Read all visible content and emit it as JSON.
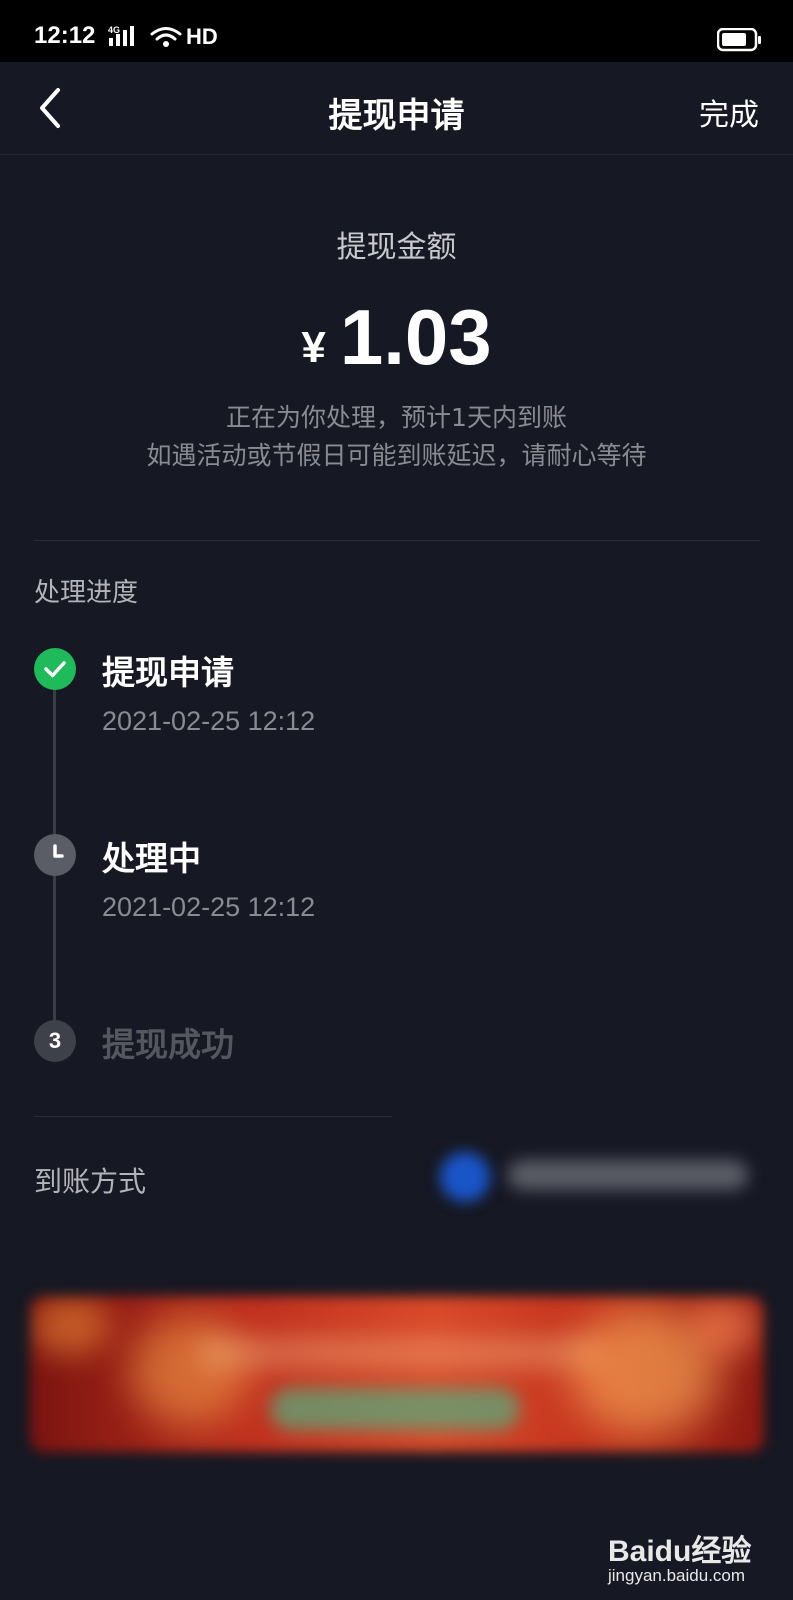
{
  "status_bar": {
    "time": "12:12",
    "network": "4G",
    "hd": "HD",
    "icons": [
      "signal-icon",
      "wifi-icon",
      "battery-icon"
    ]
  },
  "nav": {
    "back_icon": "chevron-left-icon",
    "title": "提现申请",
    "done": "完成"
  },
  "amount": {
    "label": "提现金额",
    "currency": "¥",
    "value": "1.03",
    "note_line1": "正在为你处理，预计1天内到账",
    "note_line2": "如遇活动或节假日可能到账延迟，请耐心等待"
  },
  "progress": {
    "title": "处理进度",
    "steps": [
      {
        "title": "提现申请",
        "time": "2021-02-25 12:12",
        "state": "done",
        "icon": "check-icon"
      },
      {
        "title": "处理中",
        "time": "2021-02-25 12:12",
        "state": "current",
        "icon": "clock-icon"
      },
      {
        "title": "提现成功",
        "number": "3",
        "state": "pending"
      }
    ]
  },
  "payout": {
    "label": "到账方式"
  },
  "watermark": {
    "logo": "Baidu经验",
    "url": "jingyan.baidu.com"
  },
  "colors": {
    "background": "#161823",
    "done_green": "#1fbb5a",
    "pending_gray": "#4a4c56",
    "muted_text": "#8a8b91"
  }
}
